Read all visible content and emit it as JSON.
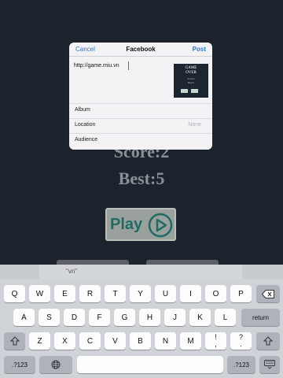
{
  "game": {
    "score": "Score:2",
    "best": "Best:5",
    "play_label": "Play"
  },
  "sheet": {
    "cancel": "Cancel",
    "title": "Facebook",
    "post": "Post",
    "text": "http://game.miu.vn",
    "thumb": {
      "title_line1": "GAME",
      "title_line2": "OVER",
      "line1": "Score:2",
      "line2": "Best:5"
    },
    "rows": [
      {
        "label": "Album",
        "value": ""
      },
      {
        "label": "Location",
        "value": "None"
      },
      {
        "label": "Audience",
        "value": ""
      }
    ]
  },
  "keyboard": {
    "suggestion": "\"vn\"",
    "row1": [
      "Q",
      "W",
      "E",
      "R",
      "T",
      "Y",
      "U",
      "I",
      "O",
      "P"
    ],
    "row2": [
      "A",
      "S",
      "D",
      "F",
      "G",
      "H",
      "J",
      "K",
      "L"
    ],
    "return_label": "return",
    "row3": [
      "Z",
      "X",
      "C",
      "V",
      "B",
      "N",
      "M"
    ],
    "row3_punct": [
      {
        "top": "!",
        "bottom": ","
      },
      {
        "top": "?",
        "bottom": "."
      }
    ],
    "numbers_label": ".?123",
    "numbers_label_right": ".?123",
    "icons": {
      "delete": "backspace-icon",
      "shift_left": "shift-icon",
      "shift_right": "shift-icon",
      "globe": "globe-icon",
      "keyboard_hide": "keyboard-hide-icon"
    }
  }
}
